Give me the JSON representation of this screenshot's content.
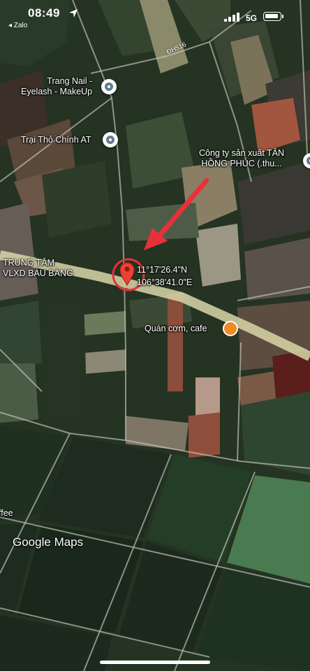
{
  "status_bar": {
    "time": "08:49",
    "back_app": "◂ Zalo",
    "network": "5G"
  },
  "map": {
    "road_label": "ĐH516",
    "pois": [
      {
        "name": "Trang Nail -\nEyelash - MakeUp",
        "icon": "poi-icon"
      },
      {
        "name": "Trại Thỏ Chính AT",
        "icon": "poi-icon"
      },
      {
        "name": "Công ty sản xuất TÂN\nHỒNG PHÚC (.thu...",
        "icon": "poi-icon"
      },
      {
        "name": "Quán cơm, cafe",
        "icon": "coffee-cup-icon"
      }
    ],
    "area_label": "TRUNG TÂM\nVLXD BÀU BÀNG",
    "coordinate_lat": "11°17'26.4\"N",
    "coordinate_lng": "106°38'41.0\"E",
    "partial_label": "ffee",
    "pin_icon": "location-pin-icon",
    "annotation": "red-arrow-icon",
    "accent_color": "#e8303a"
  },
  "branding": {
    "google": "Google",
    "maps": "Maps"
  }
}
